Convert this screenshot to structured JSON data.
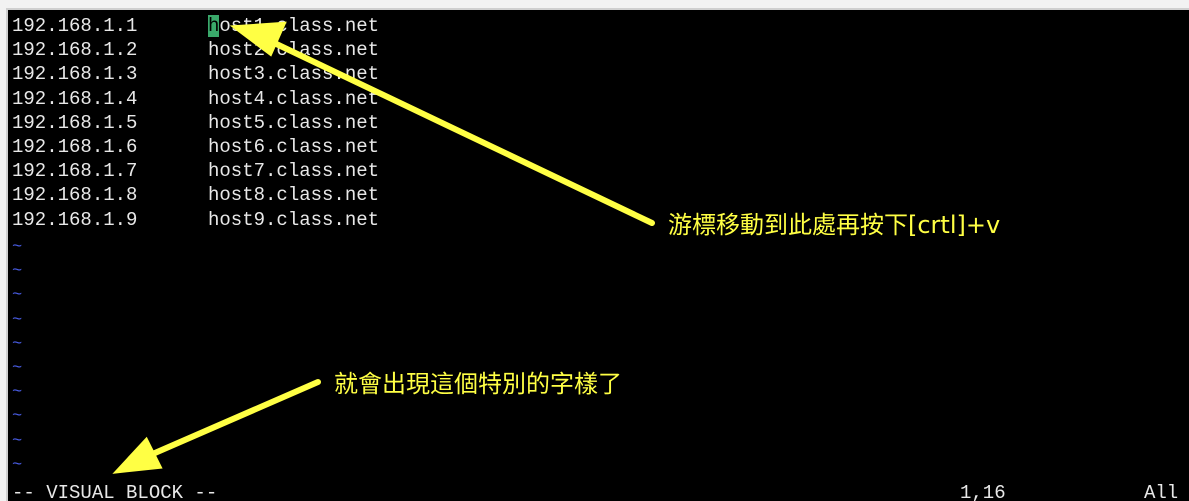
{
  "terminal": {
    "lines": [
      {
        "ip": "192.168.1.1",
        "host_first": "h",
        "host_rest": "ost1.class.net"
      },
      {
        "ip": "192.168.1.2",
        "host_first": "",
        "host_rest": "host2.class.net"
      },
      {
        "ip": "192.168.1.3",
        "host_first": "",
        "host_rest": "host3.class.net"
      },
      {
        "ip": "192.168.1.4",
        "host_first": "",
        "host_rest": "host4.class.net"
      },
      {
        "ip": "192.168.1.5",
        "host_first": "",
        "host_rest": "host5.class.net"
      },
      {
        "ip": "192.168.1.6",
        "host_first": "",
        "host_rest": "host6.class.net"
      },
      {
        "ip": "192.168.1.7",
        "host_first": "",
        "host_rest": "host7.class.net"
      },
      {
        "ip": "192.168.1.8",
        "host_first": "",
        "host_rest": "host8.class.net"
      },
      {
        "ip": "192.168.1.9",
        "host_first": "",
        "host_rest": "host9.class.net"
      }
    ],
    "tilde": "~",
    "tilde_count": 10,
    "mode": "-- VISUAL BLOCK --",
    "position": "1,16",
    "scroll": "All",
    "colors": {
      "background": "#000000",
      "text": "#e8e8e8",
      "cursor": "#3aa96b",
      "tilde": "#4a5ee8",
      "annotation": "#ffff44"
    }
  },
  "annotations": {
    "top": "游標移動到此處再按下[crtl]+v",
    "bottom": "就會出現這個特別的字樣了"
  }
}
